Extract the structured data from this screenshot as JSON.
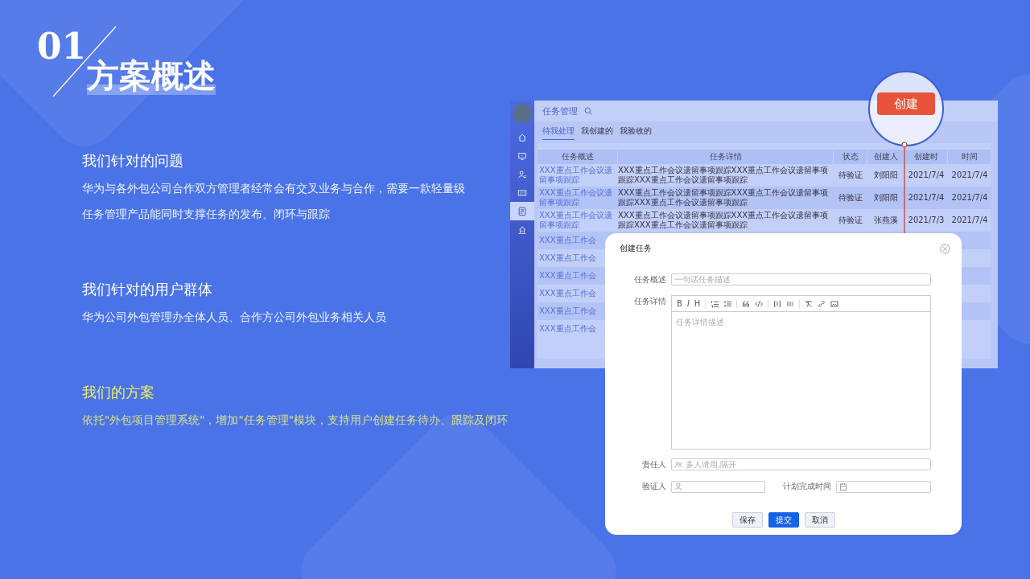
{
  "slide": {
    "number": "01",
    "title": "方案概述"
  },
  "sections": [
    {
      "heading": "我们针对的问题",
      "highlighted": false,
      "lines": [
        "华为与各外包公司合作双方管理者经常会有交叉业务与合作，需要一款轻量级",
        "任务管理产品能同时支撑任务的发布、闭环与跟踪"
      ]
    },
    {
      "heading": "我们针对的用户群体",
      "highlighted": false,
      "lines": [
        "华为公司外包管理办全体人员、合作方公司外包业务相关人员"
      ]
    },
    {
      "heading": "我们的方案",
      "highlighted": true,
      "lines": [
        "依托\"外包项目管理系统\"，增加\"任务管理\"模块，支持用户创建任务待办、跟踪及闭环"
      ]
    }
  ],
  "app": {
    "title": "任务管理",
    "nav": [
      {
        "kind": "home",
        "selected": false
      },
      {
        "kind": "monitor",
        "selected": false
      },
      {
        "kind": "user",
        "selected": false
      },
      {
        "kind": "keyboard",
        "selected": false
      },
      {
        "kind": "document",
        "selected": true
      },
      {
        "kind": "building",
        "selected": false
      }
    ],
    "tabs": [
      {
        "label": "待我处理",
        "selected": true
      },
      {
        "label": "我创建的",
        "selected": false
      },
      {
        "label": "我验收的",
        "selected": false
      }
    ],
    "table": {
      "columns": [
        "任务概述",
        "任务详情",
        "状态",
        "创建人",
        "创建时",
        "时间"
      ],
      "rows": [
        {
          "cells": [
            "XXX重点工作会议遗留事项跟踪",
            "XXX重点工作会议遗留事项跟踪XXX重点工作会议遗留事项跟踪XXX重点工作会议遗留事项跟踪",
            "待验证",
            "刘阳阳",
            "2021/7/4",
            "2021/7/4"
          ]
        },
        {
          "cells": [
            "XXX重点工作会议遗留事项跟踪",
            "XXX重点工作会议遗留事项跟踪XXX重点工作会议遗留事项跟踪XXX重点工作会议遗留事项跟踪",
            "待验证",
            "刘阳阳",
            "2021/7/4",
            "2021/7/4"
          ]
        },
        {
          "cells": [
            "XXX重点工作会议遗留事项跟踪",
            "XXX重点工作会议遗留事项跟踪XXX重点工作会议遗留事项跟踪XXX重点工作会议遗留事项跟踪",
            "待验证",
            "张燕溪",
            "2021/7/3",
            "2021/7/4"
          ]
        },
        {
          "cells": [
            "XXX重点工作会"
          ]
        },
        {
          "cells": [
            "XXX重点工作会"
          ]
        },
        {
          "cells": [
            "XXX重点工作会"
          ]
        },
        {
          "cells": [
            "XXX重点工作会"
          ]
        },
        {
          "cells": [
            "XXX重点工作会"
          ]
        },
        {
          "cells": [
            "XXX重点工作会"
          ]
        }
      ]
    }
  },
  "magnifier": {
    "button": "创建"
  },
  "dialog": {
    "title": "创建任务",
    "summary": {
      "label": "任务概述",
      "placeholder": "一句话任务描述"
    },
    "detail": {
      "label": "任务详情",
      "placeholder": "任务详情描述",
      "toolbar": [
        [
          {
            "kind": "bold",
            "label": "B"
          },
          {
            "kind": "italic",
            "label": "I"
          },
          {
            "kind": "heading",
            "label": "H"
          }
        ],
        [
          {
            "kind": "ordered-list"
          },
          {
            "kind": "bullet-list"
          }
        ],
        [
          {
            "kind": "quote"
          },
          {
            "kind": "code"
          }
        ],
        [
          {
            "kind": "bracket"
          },
          {
            "kind": "divider"
          }
        ],
        [
          {
            "kind": "clear-format"
          },
          {
            "kind": "link"
          },
          {
            "kind": "image"
          }
        ]
      ]
    },
    "assignee": {
      "label": "责任人",
      "placeholder": "多人请用,隔开"
    },
    "verifier": {
      "label": "验证人"
    },
    "due": {
      "label": "计划完成时间"
    },
    "buttons": [
      {
        "label": "保存",
        "kind": "default"
      },
      {
        "label": "提交",
        "kind": "primary"
      },
      {
        "label": "取消",
        "kind": "default"
      }
    ]
  }
}
